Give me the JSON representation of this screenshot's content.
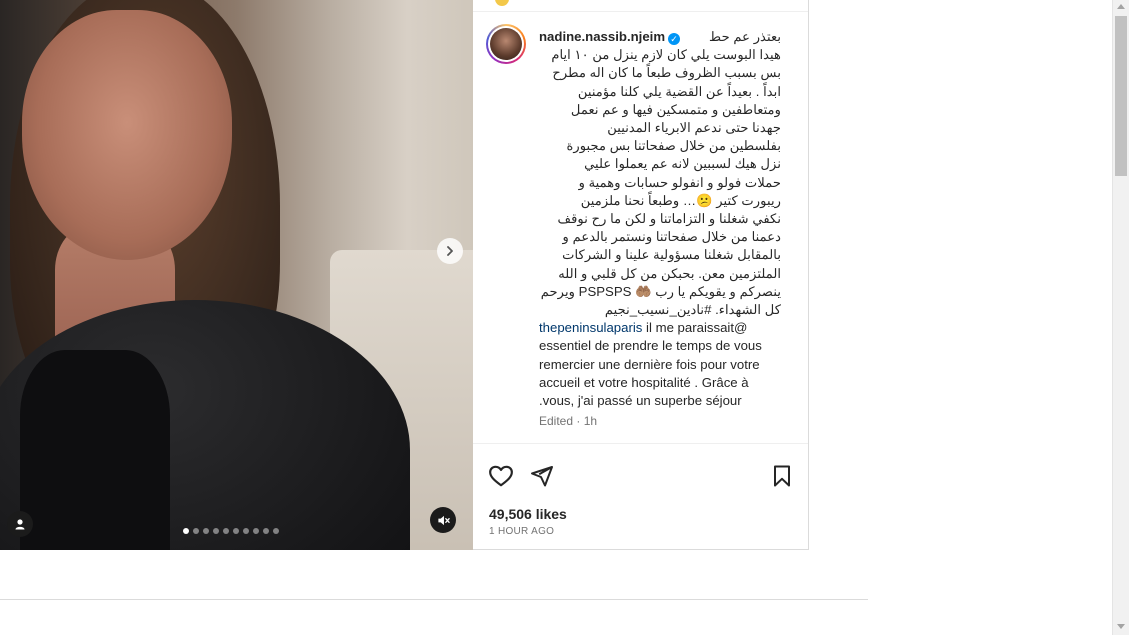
{
  "post": {
    "media": {
      "slide_count": 10,
      "active_slide": 1,
      "icons": {
        "next": "chevron-right-icon",
        "user_tag": "user-icon",
        "mute": "speaker-muted-icon"
      }
    },
    "author": {
      "username": "nadine.nassib.njeim",
      "verified": true,
      "avatar_icon": "avatar-photo"
    },
    "caption": {
      "lines": [
        "بعتذر عم حط",
        "هيدا البوست يلي كان لازم ينزل من ١٠ ايام",
        "بس بسبب الظروف طبعاً ما كان اله مطرح",
        "ابداً . بعيداً عن القضية يلي كلنا مؤمنين",
        "ومتعاطفين و متمسكين فيها و عم نعمل",
        "جهدنا حتى ندعم الابرياء المدنيين",
        "بفلسطين من خلال صفحاتنا بس مجبورة",
        "نزل هيك لسببين لانه عم يعملوا عليي",
        "حملات فولو و انفولو حسابات وهمية و",
        "ريبورت كتير 😕… وطبعاً نحنا ملزمين",
        "نكفي شغلنا و التزاماتنا و لكن ما رح نوقف",
        "دعمنا من خلال صفحاتنا ونستمر بالدعم و",
        "بالمقابل شغلنا مسؤولية علينا و الشركات",
        "الملتزمين معن. بحبكن من كل قلبي و الله",
        "ينصركم و يقويكم يا رب 🤲🏽 PSPSPS ويرحم",
        "كل الشهداء. #نادين_نسيب_نجيم"
      ],
      "mention": "thepeninsulaparis",
      "french_first": " il me paraissait@",
      "french_lines": [
        "essentiel de prendre le temps de vous",
        "remercier une dernière fois pour votre",
        "accueil et votre hospitalité . Grâce à",
        ".vous, j'ai passé un superbe séjour"
      ],
      "edited": "Edited · 1h"
    },
    "actions": {
      "like_icon": "heart-icon",
      "share_icon": "paper-plane-icon",
      "save_icon": "bookmark-icon"
    },
    "likes": "49,506 likes",
    "time_ago": "1 HOUR AGO"
  },
  "colors": {
    "verified": "#0095f6",
    "link": "#00376b",
    "muted_text": "#737373"
  }
}
